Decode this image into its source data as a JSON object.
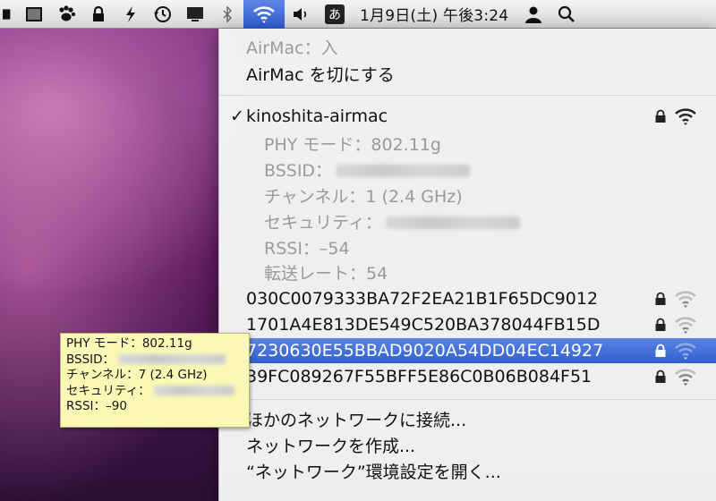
{
  "menubar": {
    "icons": [
      "black-square-icon",
      "screen-icon",
      "paw-icon",
      "lock-icon",
      "script-icon",
      "time-machine-icon",
      "display-icon",
      "bluetooth-icon",
      "wifi-icon",
      "volume-icon"
    ],
    "input_method": "あ",
    "clock": "1月9日(土) 午後3:24",
    "user_icon": "user-icon",
    "search_icon": "spotlight-search-icon"
  },
  "menu": {
    "status": "AirMac：入",
    "toggle": "AirMac を切にする",
    "current_network": {
      "checkmark": "✓",
      "name": "kinoshita-airmac",
      "phy_mode": "PHY モード：802.11g",
      "bssid": "BSSID：",
      "channel": "チャンネル：1 (2.4 GHz)",
      "security": "セキュリティ：",
      "rssi": "RSSI：–54",
      "rate": "転送レート：54"
    },
    "networks": [
      {
        "name": "030C0079333BA72F2EA21B1F65DC9012"
      },
      {
        "name": "1701A4E813DE549C520BA378044FB15D"
      },
      {
        "name": "7230630E55BBAD9020A54DD04EC14927"
      },
      {
        "name": "39FC089267F55BFF5E86C0B06B084F51"
      }
    ],
    "other_network": "ほかのネットワークに接続...",
    "create_network": "ネットワークを作成...",
    "open_prefs": "“ネットワーク”環境設定を開く..."
  },
  "tooltip": {
    "phy_mode": "PHY モード：802.11g",
    "bssid": "BSSID：",
    "channel": "チャンネル：7 (2.4 GHz)",
    "security": "セキュリティ：",
    "rssi": "RSSI：–90"
  },
  "colors": {
    "selection": "#3463d3",
    "tooltip_bg": "#fbf8b6",
    "menubar_bg": "#e6e6e6"
  }
}
